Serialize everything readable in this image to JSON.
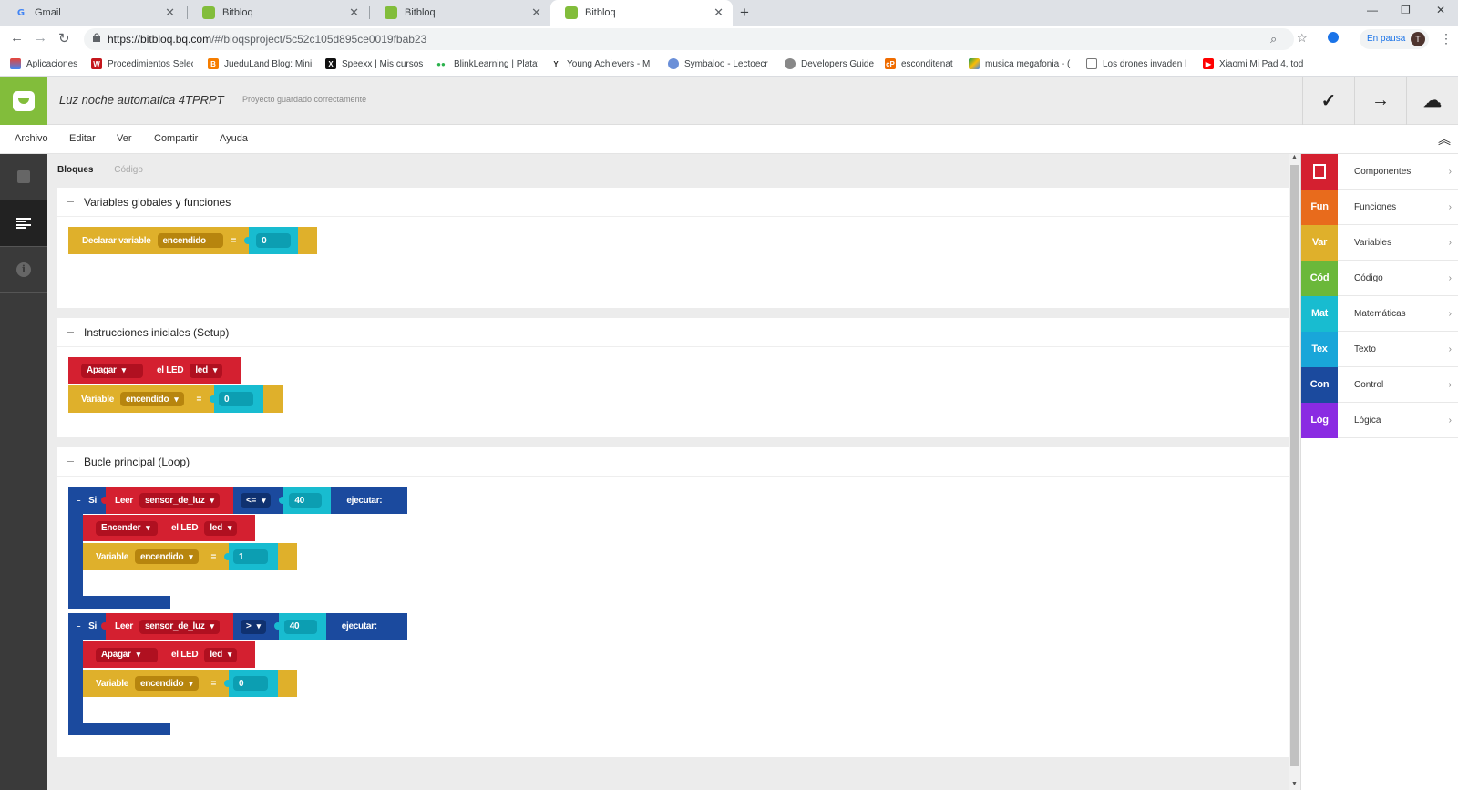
{
  "browser": {
    "tabs": [
      {
        "title": "Gmail",
        "icon": "G"
      },
      {
        "title": "Bitbloq",
        "icon": ""
      },
      {
        "title": "Bitbloq",
        "icon": ""
      },
      {
        "title": "Bitbloq",
        "icon": ""
      }
    ],
    "url_host": "https://bitbloq.bq.com",
    "url_path": "/#/bloqsproject/5c52c105d895ce0019fbab23",
    "pause_label": "En pausa",
    "avatar_initial": "T",
    "bookmarks": [
      "Aplicaciones",
      "Procedimientos Selec",
      "JueduLand Blog: Mini",
      "Speexx | Mis cursos",
      "BlinkLearning | Plataf",
      "Young Achievers - M",
      "Symbaloo - Lectoecr",
      "Developers Guide",
      "esconditenat",
      "musica megafonia - (",
      "Los drones invaden l",
      "Xiaomi Mi Pad 4, tod"
    ]
  },
  "app": {
    "project_title": "Luz noche automatica 4TPRPT",
    "status": "Proyecto guardado correctamente",
    "menu": [
      "Archivo",
      "Editar",
      "Ver",
      "Compartir",
      "Ayuda"
    ],
    "subtabs": {
      "blocks": "Bloques",
      "code": "Código"
    },
    "sections": {
      "globals": "Variables globales y funciones",
      "setup": "Instrucciones iniciales (Setup)",
      "loop": "Bucle principal (Loop)"
    },
    "categories": [
      {
        "short": "",
        "label": "Componentes",
        "color": "#d42030"
      },
      {
        "short": "Fun",
        "label": "Funciones",
        "color": "#e86b1c"
      },
      {
        "short": "Var",
        "label": "Variables",
        "color": "#dfb02b"
      },
      {
        "short": "Cód",
        "label": "Código",
        "color": "#6bb83a"
      },
      {
        "short": "Mat",
        "label": "Matemáticas",
        "color": "#18bcd0"
      },
      {
        "short": "Tex",
        "label": "Texto",
        "color": "#19a6d9"
      },
      {
        "short": "Con",
        "label": "Control",
        "color": "#1b4a9e"
      },
      {
        "short": "Lóg",
        "label": "Lógica",
        "color": "#8a2be2"
      }
    ]
  },
  "blocks": {
    "declare": {
      "label": "Declarar variable",
      "name": "encendido",
      "eq": "=",
      "value": "0"
    },
    "setup_led": {
      "action": "Apagar",
      "mid": "el LED",
      "target": "led"
    },
    "setup_var": {
      "label": "Variable",
      "name": "encendido",
      "eq": "=",
      "value": "0"
    },
    "if1": {
      "si": "Si",
      "read": "Leer",
      "sensor": "sensor_de_luz",
      "op": "<=",
      "value": "40",
      "exec": "ejecutar:"
    },
    "if1_led": {
      "action": "Encender",
      "mid": "el LED",
      "target": "led"
    },
    "if1_var": {
      "label": "Variable",
      "name": "encendido",
      "eq": "=",
      "value": "1"
    },
    "if2": {
      "si": "Si",
      "read": "Leer",
      "sensor": "sensor_de_luz",
      "op": ">",
      "value": "40",
      "exec": "ejecutar:"
    },
    "if2_led": {
      "action": "Apagar",
      "mid": "el LED",
      "target": "led"
    },
    "if2_var": {
      "label": "Variable",
      "name": "encendido",
      "eq": "=",
      "value": "0"
    }
  }
}
